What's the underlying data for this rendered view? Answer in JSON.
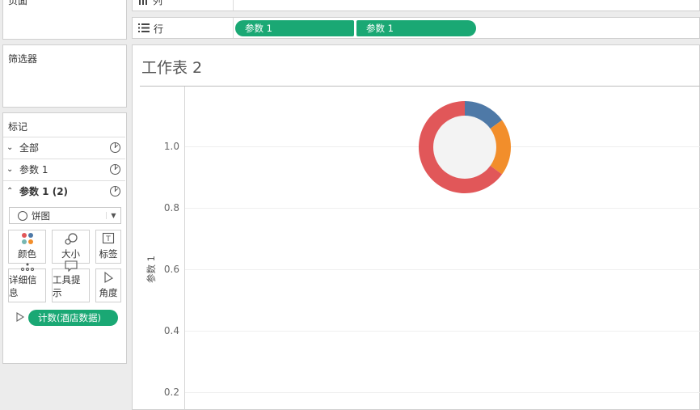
{
  "left": {
    "pages_label": "页面",
    "filters_label": "筛选器",
    "marks": {
      "title": "标记",
      "rows": [
        {
          "label": "全部",
          "expanded": false
        },
        {
          "label": "参数 1",
          "expanded": false
        },
        {
          "label": "参数 1 (2)",
          "expanded": true
        }
      ],
      "mark_type": "饼图",
      "tiles": [
        "颜色",
        "大小",
        "标签",
        "详细信息",
        "工具提示",
        "角度"
      ],
      "angle_pill": "计数(酒店数据)"
    }
  },
  "shelves": {
    "columns_label": "列",
    "rows_label": "行",
    "row_pills": [
      "参数 1",
      "参数 1"
    ]
  },
  "sheet": {
    "title": "工作表 2",
    "axis_title": "参数 1",
    "ticks": [
      "1.0",
      "0.8",
      "0.6",
      "0.4",
      "0.2"
    ],
    "colors": {
      "accent": "#1aa874",
      "blue": "#4e79a7",
      "orange": "#f28e2b",
      "red": "#e15759"
    }
  },
  "chart_data": {
    "type": "pie",
    "slices": [
      {
        "color": "#4e79a7",
        "value": 15
      },
      {
        "color": "#f28e2b",
        "value": 20
      },
      {
        "color": "#e15759",
        "value": 65
      }
    ],
    "y_ticks": [
      1.0,
      0.8,
      0.6,
      0.4,
      0.2
    ],
    "ylabel": "参数 1",
    "y_value": 1.0
  }
}
